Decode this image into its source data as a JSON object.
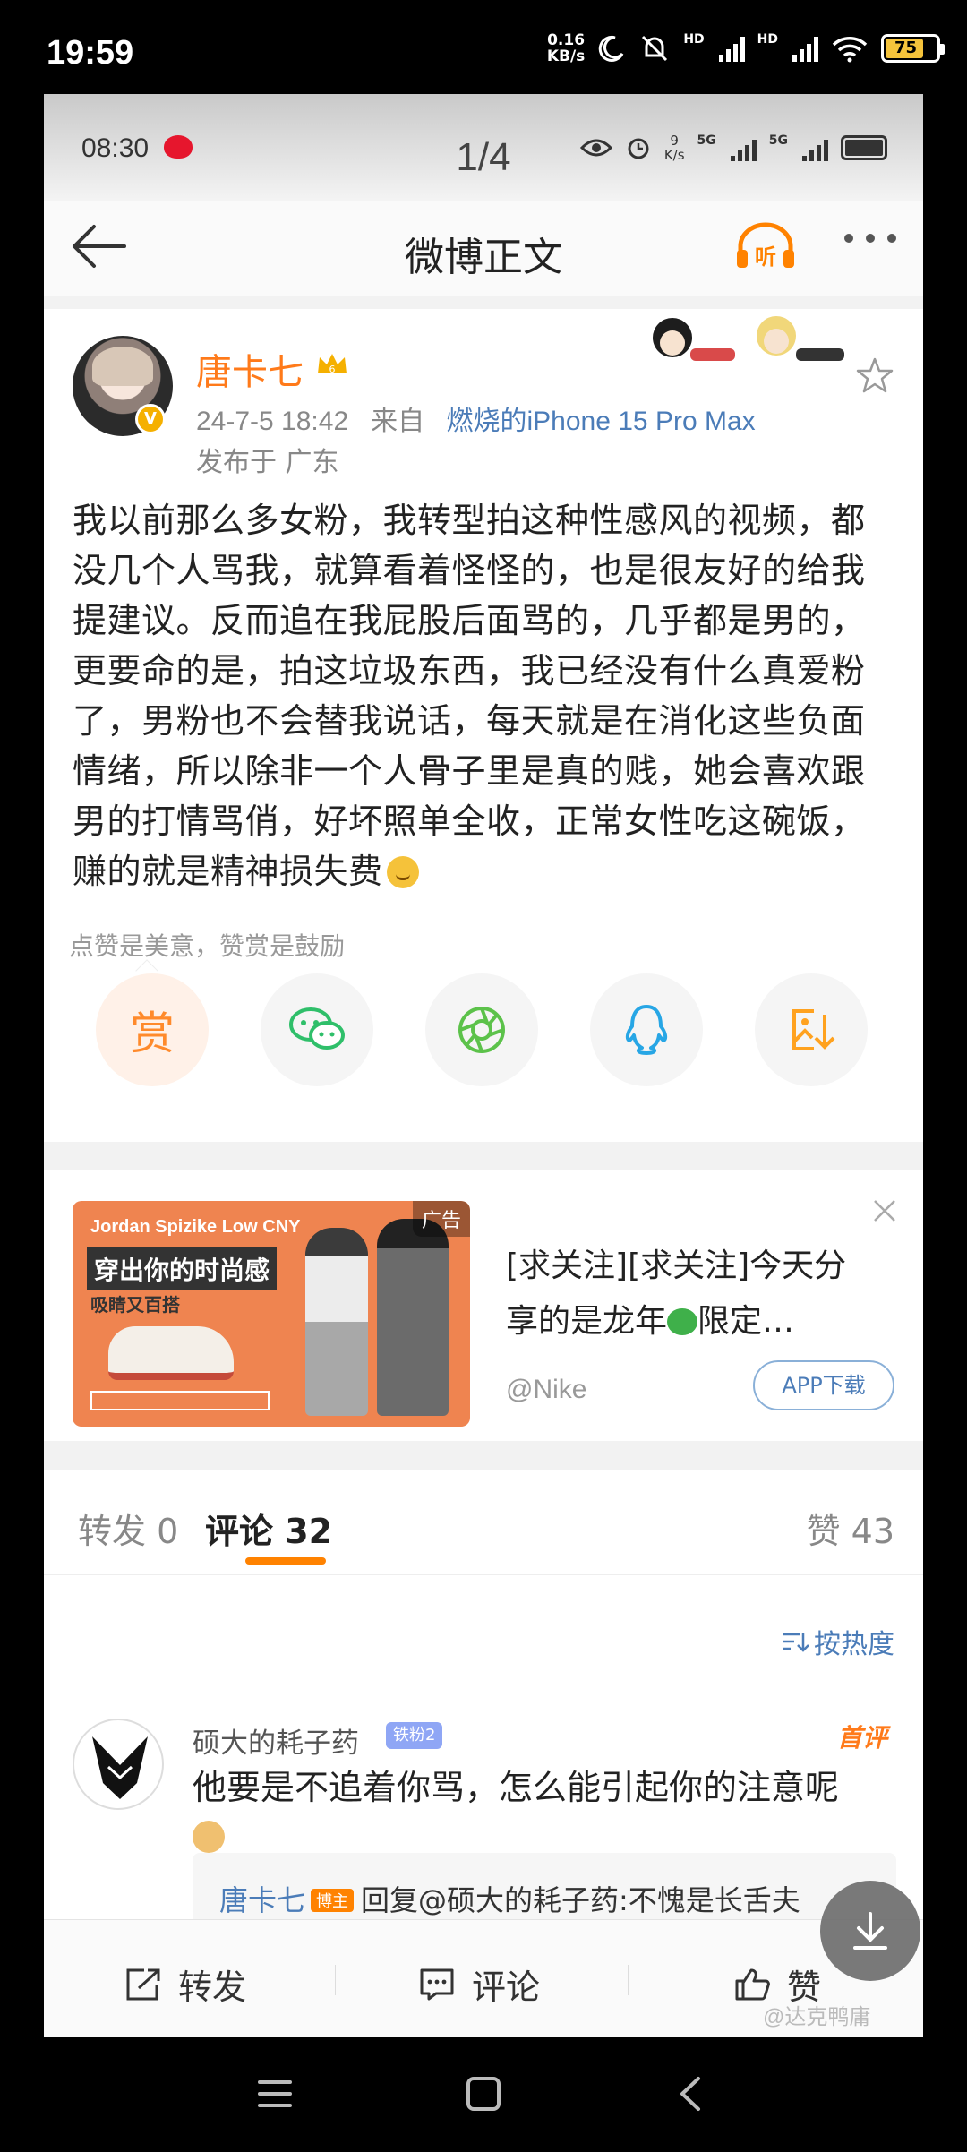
{
  "outer_status": {
    "time": "19:59",
    "net_speed_value": "0.16",
    "net_speed_unit": "KB/s",
    "hd_1": "HD",
    "hd_2": "HD",
    "battery": "75"
  },
  "inner_status": {
    "time": "08:30",
    "page_indicator": "1/4",
    "net_speed_value": "9",
    "net_speed_unit": "K/s",
    "net_1": "5G",
    "net_2": "5G"
  },
  "nav": {
    "title": "微博正文"
  },
  "post": {
    "username": "唐卡七",
    "timestamp": "24-7-5 18:42",
    "source_prefix": "来自",
    "source": "燃烧的iPhone 15 Pro Max",
    "location": "发布于 广东",
    "text": "我以前那么多女粉，我转型拍这种性感风的视频，都没几个人骂我，就算看着怪怪的，也是很友好的给我提建议。反而追在我屁股后面骂的，几乎都是男的，更要命的是，拍这垃圾东西，我已经没有什么真爱粉了，男粉也不会替我说话，每天就是在消化这些负面情绪，所以除非一个人骨子里是真的贱，她会喜欢跟男的打情骂俏，好坏照单全收，正常女性吃这碗饭，赚的就是精神损失费",
    "reward_tip": "点赞是美意，赞赏是鼓励",
    "reward_label": "赏"
  },
  "ad": {
    "image_line1": "Jordan Spizike Low CNY",
    "image_line2": "穿出你的时尚感",
    "image_line3": "吸睛又百搭",
    "tag": "广告",
    "text": "[求关注][求关注]今天分享的是龙年",
    "text_suffix": "限定…",
    "handle": "@Nike",
    "download": "APP下载"
  },
  "tabs": {
    "repost": "转发 0",
    "comment": "评论 32",
    "like": "赞 43"
  },
  "comments": {
    "sort": "按热度",
    "items": [
      {
        "name": "硕大的耗子药",
        "badge": "铁粉2",
        "flag": "首评",
        "text": "他要是不追着你骂，怎么能引起你的注意呢",
        "reply_name": "唐卡七",
        "reply_badge": "博主",
        "reply_text": "回复@硕大的耗子药:不愧是长舌夫"
      }
    ]
  },
  "bottom_bar": {
    "repost": "转发",
    "comment": "评论",
    "like": "赞"
  },
  "watermark": "@达克鸭庸",
  "colors": {
    "accent_orange": "#ff8200",
    "link_blue": "#4b7cb8",
    "username_orange": "#ff7a1a"
  }
}
